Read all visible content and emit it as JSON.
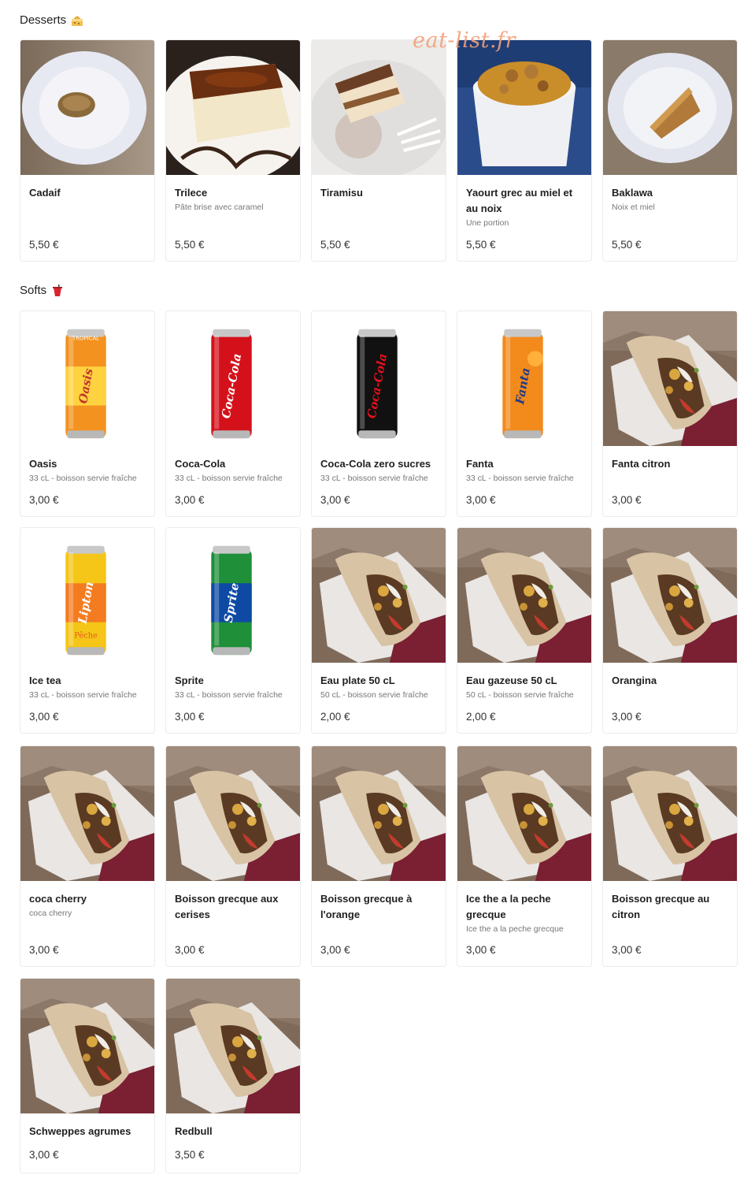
{
  "watermark": "eat-list.fr",
  "sections": [
    {
      "title": "Desserts",
      "icon": "cake-icon",
      "items": [
        {
          "name": "Cadaif",
          "desc": "",
          "price": "5,50 €",
          "image": "kadaif-plate"
        },
        {
          "name": "Trilece",
          "desc": "Pâte brise avec caramel",
          "price": "5,50 €",
          "image": "trilece-cake"
        },
        {
          "name": "Tiramisu",
          "desc": "",
          "price": "5,50 €",
          "image": "tiramisu-slice"
        },
        {
          "name": "Yaourt grec au miel et au noix",
          "desc": "Une portion",
          "price": "5,50 €",
          "image": "greek-yogurt-honey"
        },
        {
          "name": "Baklawa",
          "desc": "Noix et miel",
          "price": "5,50 €",
          "image": "baklava-plate"
        }
      ]
    },
    {
      "title": "Softs",
      "icon": "drink-cup-icon",
      "items": [
        {
          "name": "Oasis",
          "desc": "33 cL - boisson servie fraîche",
          "price": "3,00 €",
          "image": "oasis-can"
        },
        {
          "name": "Coca-Cola",
          "desc": "33 cL - boisson servie fraîche",
          "price": "3,00 €",
          "image": "coca-cola-can"
        },
        {
          "name": "Coca-Cola zero sucres",
          "desc": "33 cL - boisson servie fraîche",
          "price": "3,00 €",
          "image": "coca-zero-can"
        },
        {
          "name": "Fanta",
          "desc": "33 cL - boisson servie fraîche",
          "price": "3,00 €",
          "image": "fanta-can"
        },
        {
          "name": "Fanta citron",
          "desc": "",
          "price": "3,00 €",
          "image": "gyros-placeholder"
        },
        {
          "name": "Ice tea",
          "desc": "33 cL - boisson servie fraîche",
          "price": "3,00 €",
          "image": "lipton-can"
        },
        {
          "name": "Sprite",
          "desc": "33 cL - boisson servie fraîche",
          "price": "3,00 €",
          "image": "sprite-can"
        },
        {
          "name": "Eau plate 50 cL",
          "desc": "50 cL - boisson servie fraîche",
          "price": "2,00 €",
          "image": "gyros-placeholder"
        },
        {
          "name": "Eau gazeuse 50 cL",
          "desc": "50 cL - boisson servie fraîche",
          "price": "2,00 €",
          "image": "gyros-placeholder"
        },
        {
          "name": "Orangina",
          "desc": "",
          "price": "3,00 €",
          "image": "gyros-placeholder"
        },
        {
          "name": "coca cherry",
          "desc": "coca cherry",
          "price": "3,00 €",
          "image": "gyros-placeholder"
        },
        {
          "name": "Boisson grecque aux cerises",
          "desc": "",
          "price": "3,00 €",
          "image": "gyros-placeholder"
        },
        {
          "name": "Boisson grecque à l'orange",
          "desc": "",
          "price": "3,00 €",
          "image": "gyros-placeholder"
        },
        {
          "name": "Ice the a la peche grecque",
          "desc": "Ice the a la peche grecque",
          "price": "3,00 €",
          "image": "gyros-placeholder"
        },
        {
          "name": "Boisson grecque au citron",
          "desc": "",
          "price": "3,00 €",
          "image": "gyros-placeholder"
        },
        {
          "name": "Schweppes agrumes",
          "desc": "",
          "price": "3,00 €",
          "image": "gyros-placeholder"
        },
        {
          "name": "Redbull",
          "desc": "",
          "price": "3,50 €",
          "image": "gyros-placeholder"
        }
      ]
    }
  ],
  "colors": {
    "watermark": "#f3a07a",
    "card_border": "#ececec",
    "text_desc": "#777777"
  }
}
